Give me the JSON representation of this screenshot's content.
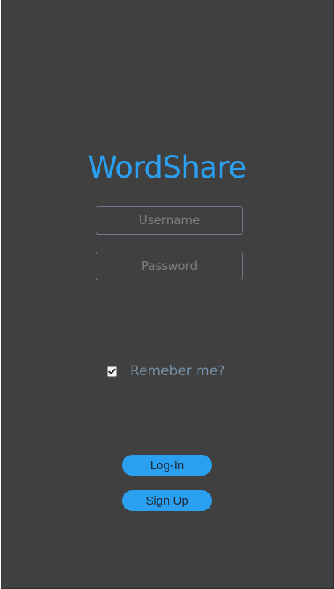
{
  "app": {
    "title": "WordShare"
  },
  "form": {
    "username": {
      "placeholder": "Username",
      "value": ""
    },
    "password": {
      "placeholder": "Password",
      "value": ""
    },
    "remember": {
      "label": "Remeber me?",
      "checked": true
    }
  },
  "buttons": {
    "login_label": "Log-In",
    "signup_label": "Sign Up"
  },
  "colors": {
    "background": "#404040",
    "accent": "#2ba0f0",
    "field_border": "#6c7c8c",
    "label": "#7590a8"
  },
  "icons": {
    "checkbox_mark": "checkmark-icon"
  }
}
